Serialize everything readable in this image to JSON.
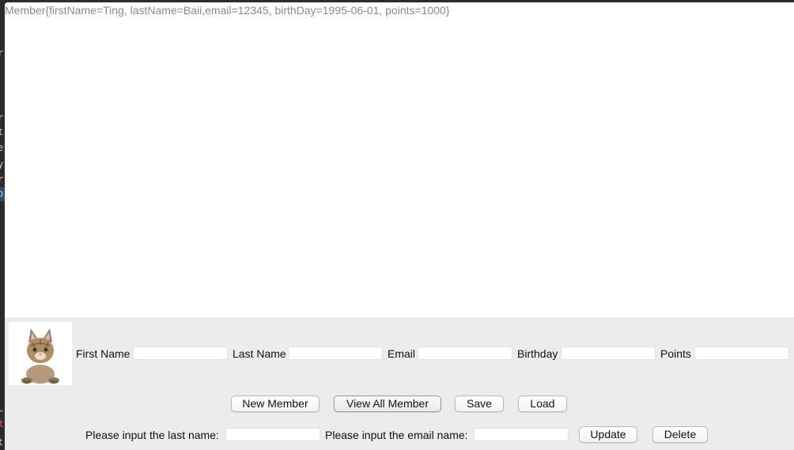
{
  "output": {
    "text": "Member{firstName=Ting, lastName=Baii,email=12345, birthDay=1995-06-01, points=1000}"
  },
  "form": {
    "photo_icon": "cat-photo",
    "first_name_label": "First Name",
    "first_name_value": "",
    "last_name_label": "Last Name",
    "last_name_value": "",
    "email_label": "Email",
    "email_value": "",
    "birthday_label": "Birthday",
    "birthday_value": "",
    "points_label": "Points",
    "points_value": ""
  },
  "buttons": {
    "new_member": "New Member",
    "view_all_member": "View All Member",
    "save": "Save",
    "load": "Load",
    "update": "Update",
    "delete": "Delete"
  },
  "search": {
    "last_name_prompt": "Please input the last name:",
    "last_name_value": "",
    "email_prompt": "Please input the email name:",
    "email_value": ""
  },
  "background_ide": {
    "glyphs": [
      "r",
      "r",
      "t",
      "e",
      "y",
      "r",
      "oi",
      "L",
      "t",
      "t"
    ]
  },
  "colors": {
    "window_bg": "#ececec",
    "output_text": "#8a8a8a",
    "background_ide": "#2b2b2b"
  }
}
